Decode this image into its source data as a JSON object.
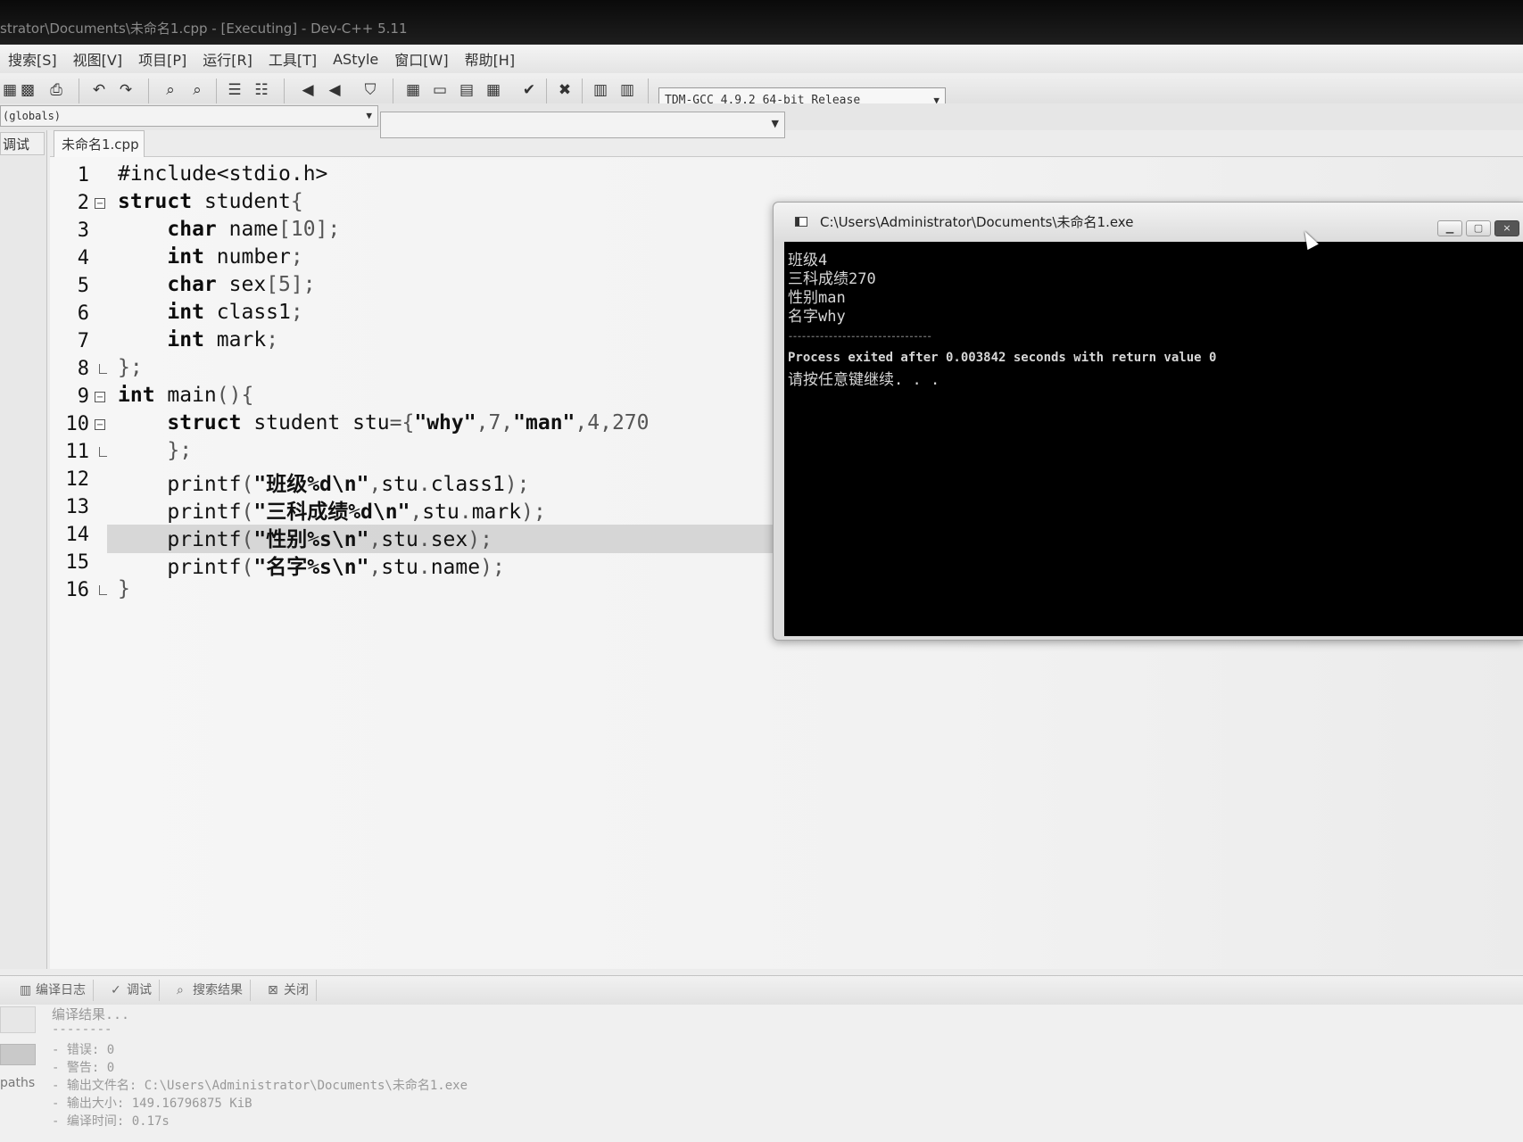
{
  "window": {
    "title": "strator\\Documents\\未命名1.cpp - [Executing] - Dev-C++ 5.11"
  },
  "menu": [
    "搜索[S]",
    "视图[V]",
    "项目[P]",
    "运行[R]",
    "工具[T]",
    "AStyle",
    "窗口[W]",
    "帮助[H]"
  ],
  "toolbar": {
    "compiler": "TDM-GCC 4.9.2 64-bit Release",
    "globals": "(globals)"
  },
  "left_panel": {
    "tab": "调试"
  },
  "editor": {
    "file_tab": "未命名1.cpp",
    "line_numbers": [
      "1",
      "2",
      "3",
      "4",
      "5",
      "6",
      "7",
      "8",
      "9",
      "10",
      "11",
      "12",
      "13",
      "14",
      "15",
      "16"
    ]
  },
  "console": {
    "title": "C:\\Users\\Administrator\\Documents\\未命名1.exe",
    "lines": [
      "班级4",
      "三科成绩270",
      "性别man",
      "名字why"
    ],
    "divider": "--------------------------------",
    "process": "Process exited after 0.003842 seconds with return value 0",
    "continue": "请按任意键继续. . ."
  },
  "bottom": {
    "tabs": [
      "编译日志",
      "调试",
      "搜索结果",
      "关闭"
    ],
    "paths_label": "paths",
    "log": [
      "编译结果...",
      "--------",
      "- 错误: 0",
      "- 警告: 0",
      "- 输出文件名: C:\\Users\\Administrator\\Documents\\未命名1.exe",
      "- 输出大小: 149.16796875 KiB",
      "- 编译时间: 0.17s"
    ]
  }
}
